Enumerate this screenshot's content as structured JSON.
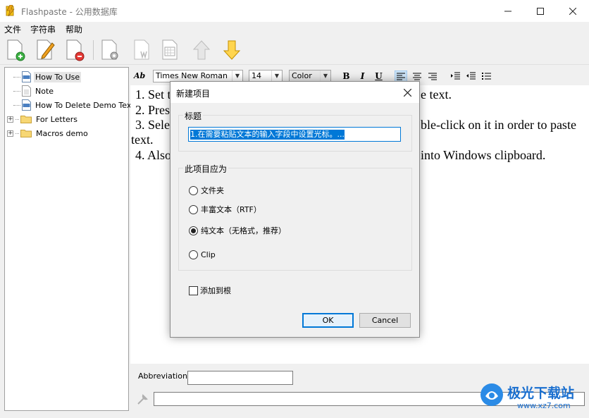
{
  "window": {
    "title": "Flashpaste - 公用数据库",
    "minimize_icon": "minimize-icon",
    "maximize_icon": "maximize-icon",
    "close_icon": "close-icon"
  },
  "menu": [
    "文件",
    "字符串",
    "帮助"
  ],
  "toolbar": {
    "buttons": [
      "add-item-icon",
      "edit-item-icon",
      "delete-item-icon",
      "settings-doc-icon",
      "word-doc-icon",
      "keyboard-doc-icon",
      "move-up-icon",
      "move-down-icon"
    ]
  },
  "tree": {
    "items": [
      {
        "label": "How To Use",
        "icon": "rtf-doc-icon",
        "selected": true
      },
      {
        "label": "Note",
        "icon": "plain-doc-icon"
      },
      {
        "label": "How To Delete Demo Text",
        "icon": "rtf-doc-icon"
      },
      {
        "label": "For Letters",
        "icon": "folder-icon",
        "expander": "+"
      },
      {
        "label": "Macros demo",
        "icon": "folder-icon",
        "expander": "+"
      }
    ],
    "rtf_badge": "RTF"
  },
  "format_bar": {
    "style_label": "Ab",
    "font": "Times New Roman",
    "size": "14",
    "color_label": "Color",
    "bold": "B",
    "italic": "I",
    "underline": "U"
  },
  "editor": {
    "lines": [
      "1. Set t",
      "e text.",
      "2. Pres",
      "3. Sele",
      "ble-click on it in order to paste",
      "text.",
      "4. Also",
      "into Windows clipboard."
    ]
  },
  "bottom": {
    "abbreviation_label": "Abbreviation:",
    "abbreviation_value": "",
    "text_value": ""
  },
  "dialog": {
    "title": "新建项目",
    "title_group": "标题",
    "title_value": "1.在需要粘贴文本的输入字段中设置光标。...",
    "type_group": "此项目应为",
    "options": [
      {
        "label": "文件夹",
        "checked": false
      },
      {
        "label": "丰富文本（RTF）",
        "checked": false
      },
      {
        "label": "纯文本（无格式，推荐）",
        "checked": true
      },
      {
        "label": "Clip",
        "checked": false
      }
    ],
    "add_to_root_label": "添加到根",
    "add_to_root_checked": false,
    "ok_label": "OK",
    "cancel_label": "Cancel"
  },
  "watermark": {
    "text": "极光下载站",
    "url": "www.xz7.com"
  }
}
